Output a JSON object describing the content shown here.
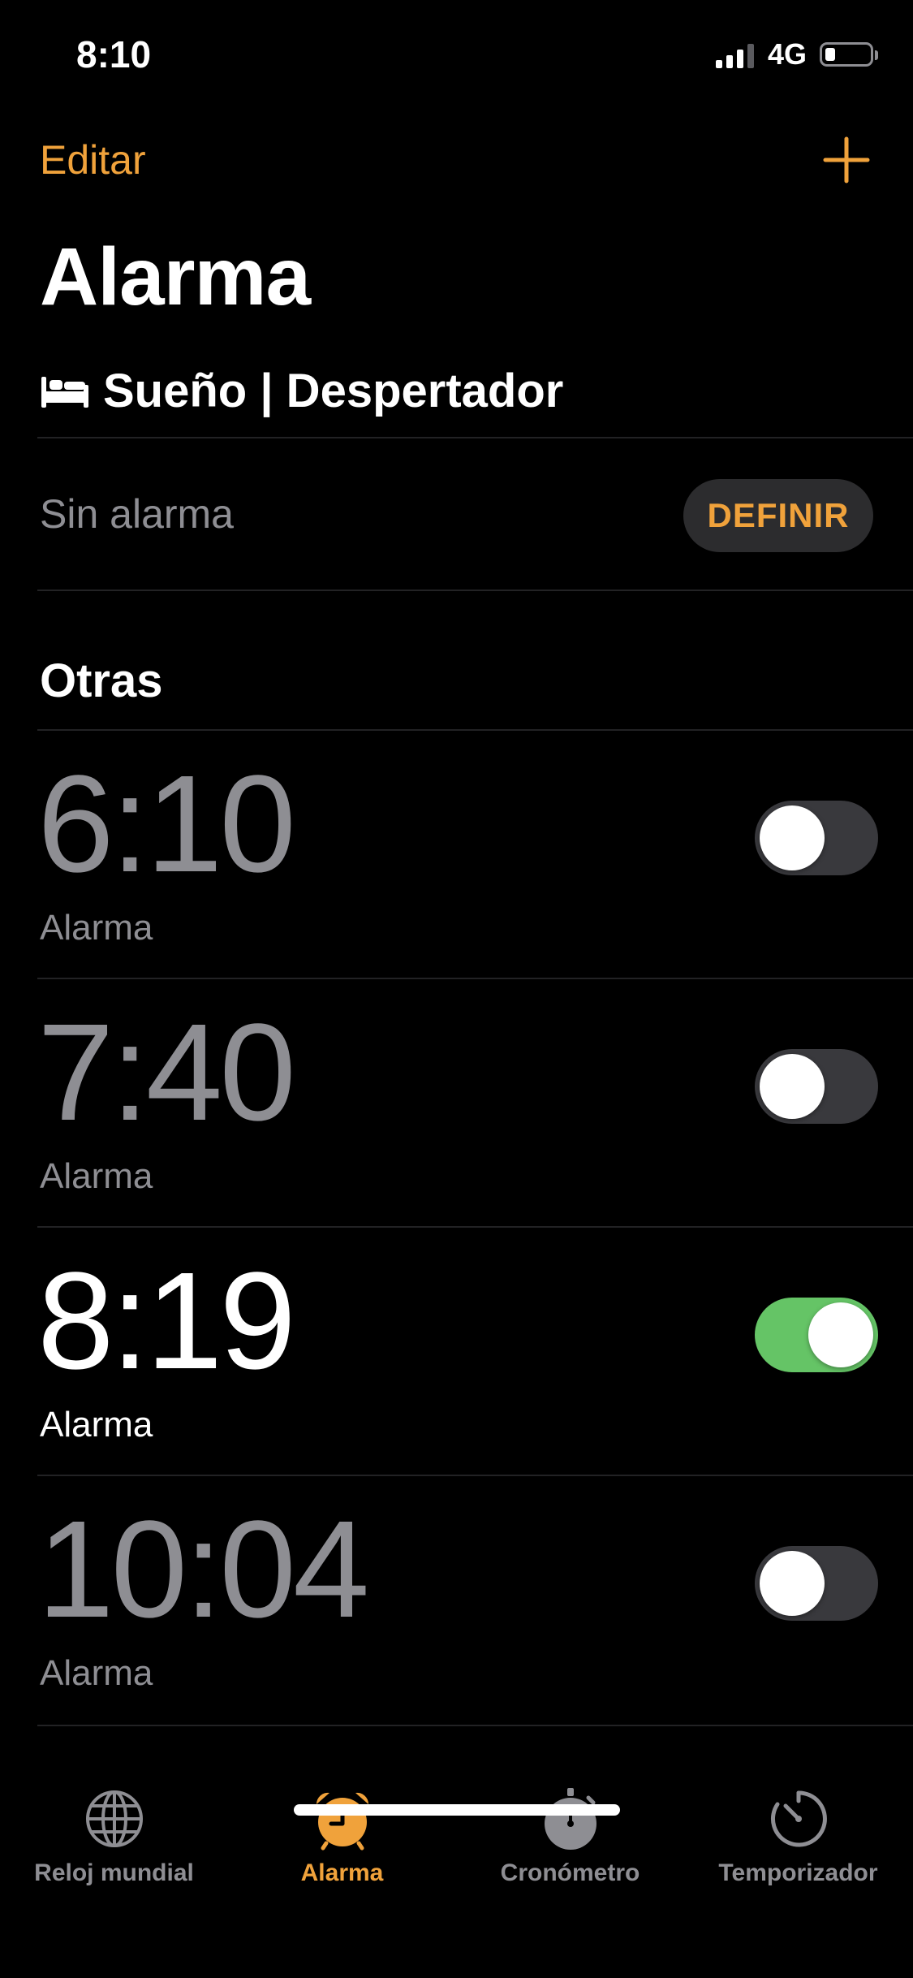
{
  "status_bar": {
    "time": "8:10",
    "network": "4G",
    "battery_level": 0.2
  },
  "header": {
    "edit_label": "Editar",
    "add_icon": "plus-icon",
    "title": "Alarma"
  },
  "sleep": {
    "icon": "bed-icon",
    "title": "Sueño | Despertador",
    "no_alarm_text": "Sin alarma",
    "define_label": "DEFINIR"
  },
  "others": {
    "title": "Otras",
    "alarms": [
      {
        "time": "6:10",
        "label": "Alarma",
        "enabled": false
      },
      {
        "time": "7:40",
        "label": "Alarma",
        "enabled": false
      },
      {
        "time": "8:19",
        "label": "Alarma",
        "enabled": true
      },
      {
        "time": "10:04",
        "label": "Alarma",
        "enabled": false
      }
    ]
  },
  "tabbar": {
    "tabs": [
      {
        "label": "Reloj mundial",
        "icon": "globe-icon",
        "active": false
      },
      {
        "label": "Alarma",
        "icon": "alarm-clock-icon",
        "active": true
      },
      {
        "label": "Cronómetro",
        "icon": "stopwatch-icon",
        "active": false
      },
      {
        "label": "Temporizador",
        "icon": "timer-icon",
        "active": false
      }
    ]
  },
  "colors": {
    "accent": "#f0a23b",
    "toggle_on": "#65c466",
    "toggle_off": "#39393d",
    "secondary_text": "#8e8e93"
  }
}
